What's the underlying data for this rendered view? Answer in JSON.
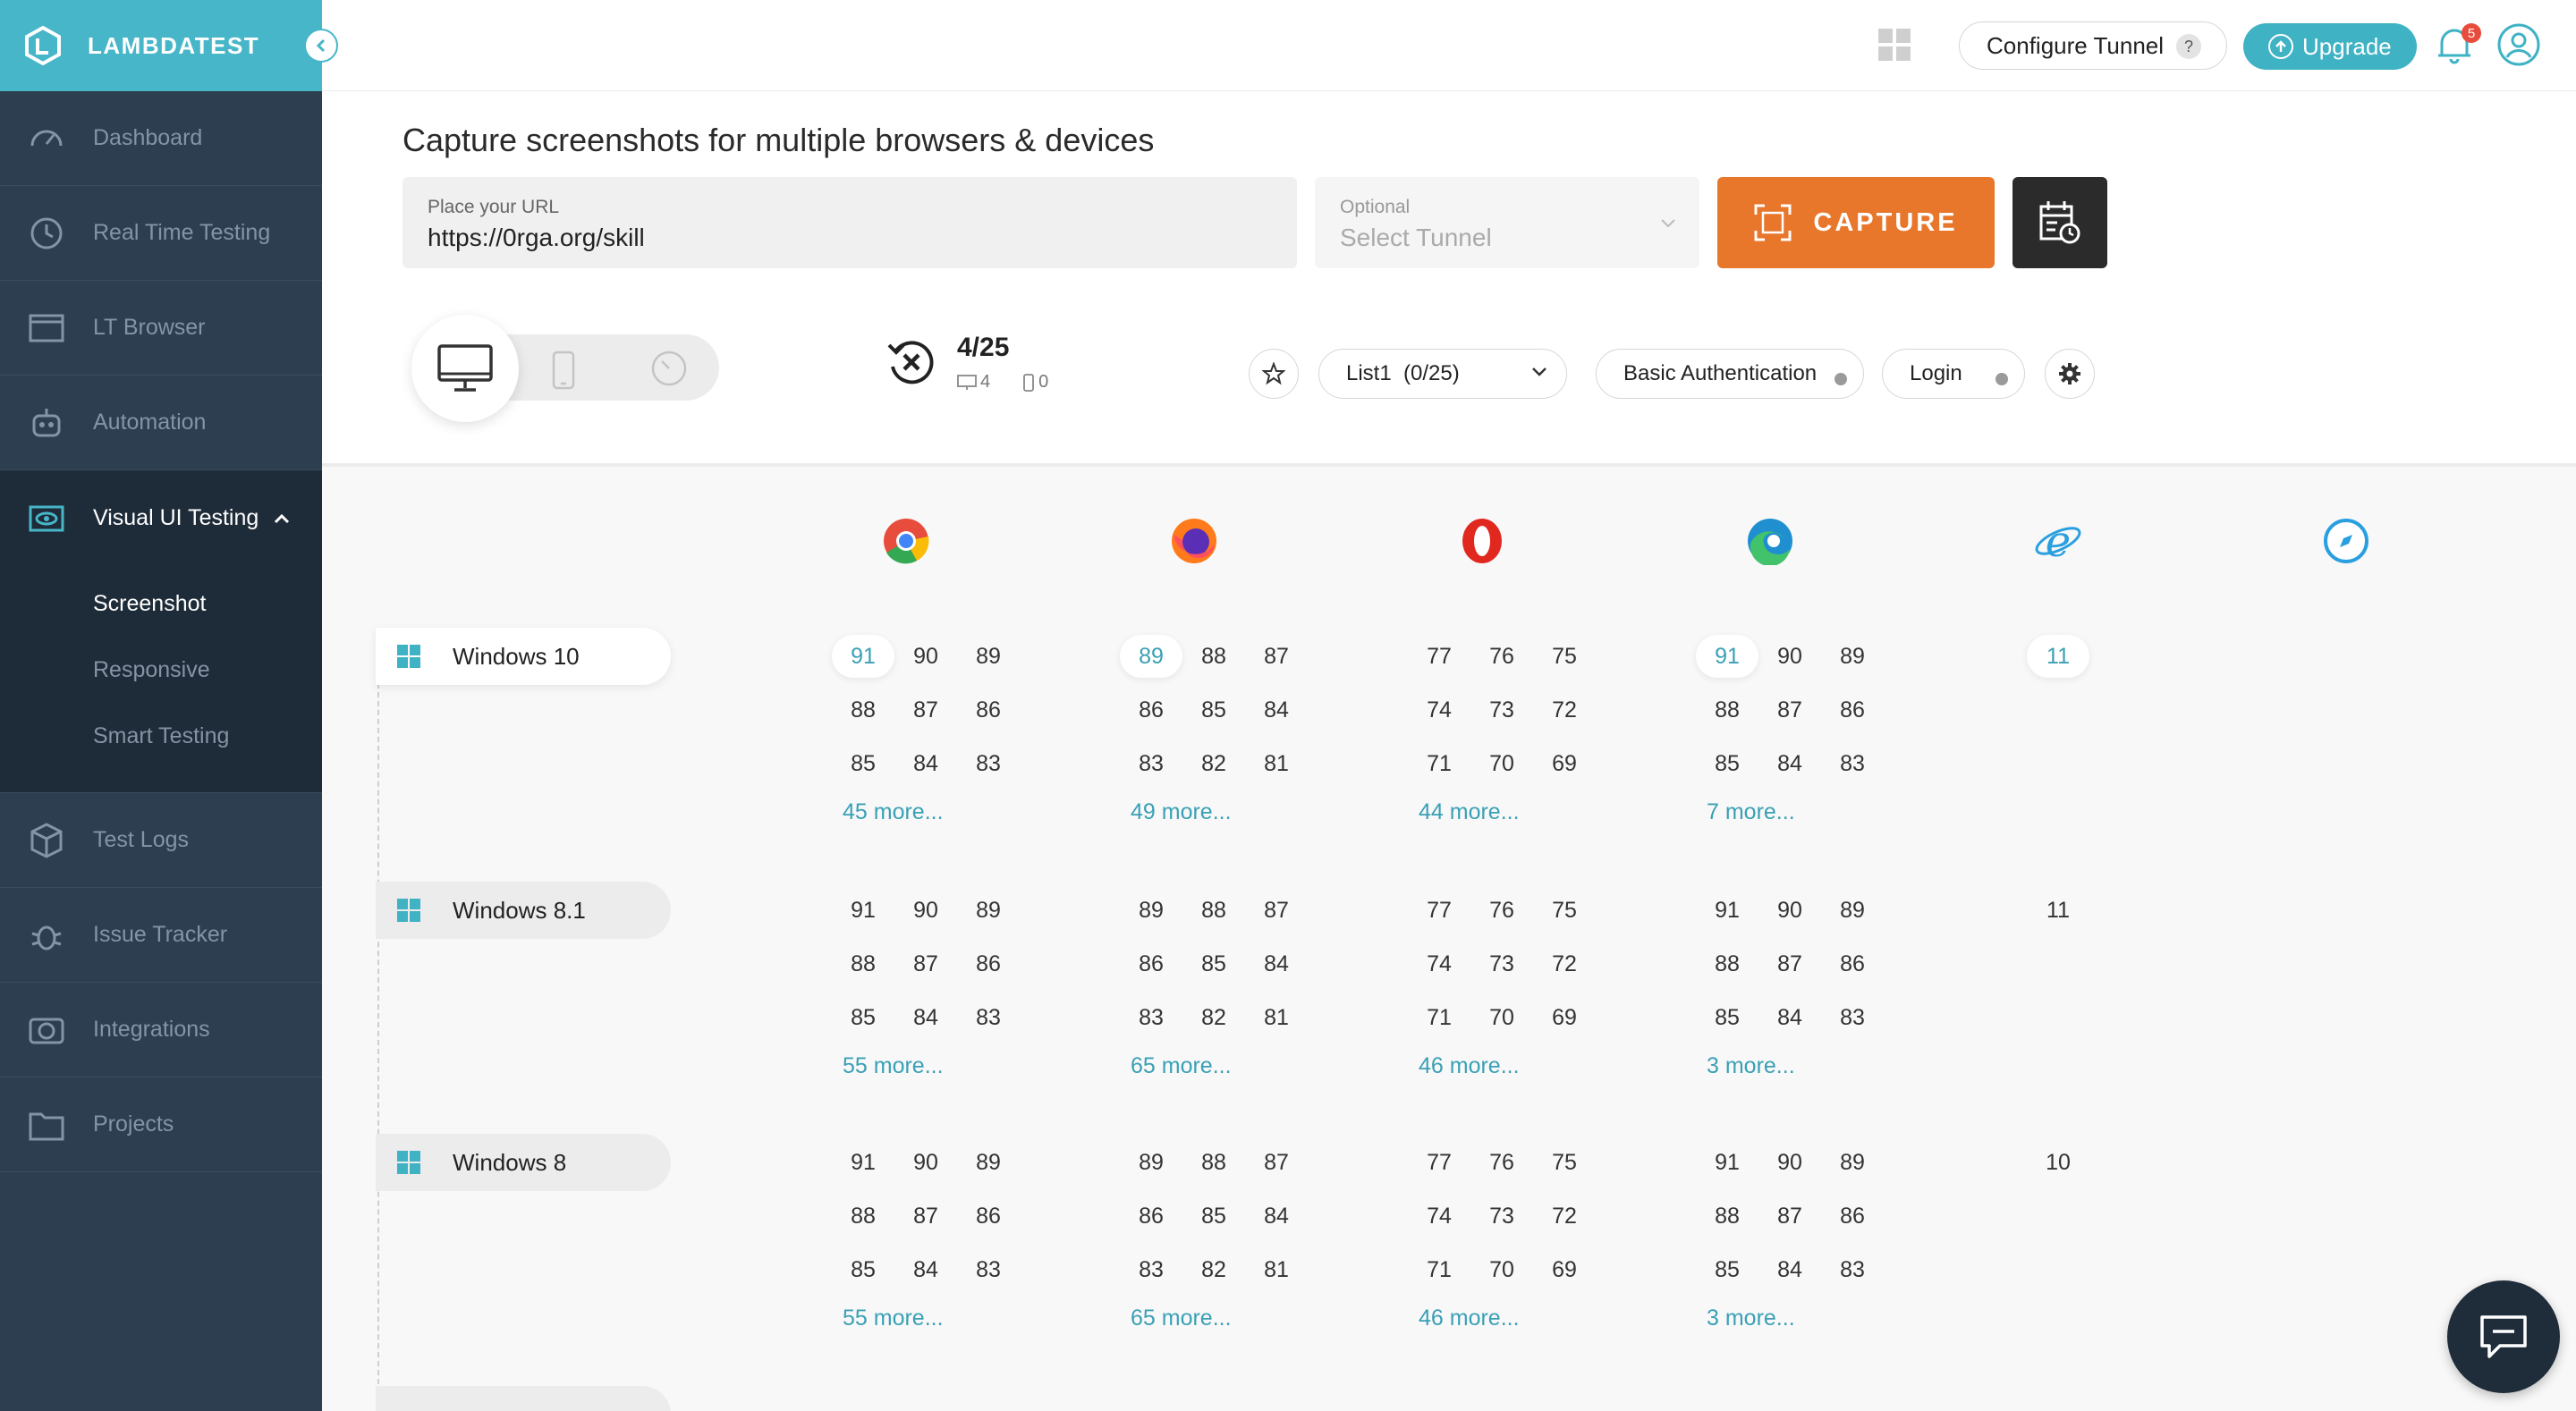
{
  "brand": {
    "name": "LAMBDATEST"
  },
  "sidebar": {
    "items": [
      {
        "label": "Dashboard",
        "icon": "speedometer-icon"
      },
      {
        "label": "Real Time Testing",
        "icon": "clock-icon"
      },
      {
        "label": "LT Browser",
        "icon": "browser-icon"
      },
      {
        "label": "Automation",
        "icon": "robot-icon"
      },
      {
        "label": "Visual UI Testing",
        "icon": "eye-icon",
        "active": true
      },
      {
        "label": "Test Logs",
        "icon": "cube-icon"
      },
      {
        "label": "Issue Tracker",
        "icon": "bug-icon"
      },
      {
        "label": "Integrations",
        "icon": "plug-icon"
      },
      {
        "label": "Projects",
        "icon": "folder-icon"
      }
    ],
    "subitems": [
      {
        "label": "Screenshot",
        "active": true
      },
      {
        "label": "Responsive"
      },
      {
        "label": "Smart Testing"
      }
    ]
  },
  "header": {
    "configure_tunnel": "Configure Tunnel",
    "help": "?",
    "upgrade": "Upgrade",
    "notification_count": "5"
  },
  "main": {
    "title": "Capture screenshots for multiple browsers & devices",
    "url_label": "Place your URL",
    "url_value": "https://0rga.org/skill",
    "tunnel_label": "Optional",
    "tunnel_placeholder": "Select Tunnel",
    "capture_label": "CAPTURE",
    "counter": "4/25",
    "desktop_count": "4",
    "mobile_count": "0",
    "list_label": "List1  (0/25)",
    "auth_label": "Basic Authentication",
    "login_label": "Login"
  },
  "browsers": [
    "chrome-icon",
    "firefox-icon",
    "opera-icon",
    "edge-icon",
    "ie-icon",
    "safari-icon"
  ],
  "os_rows": [
    {
      "name": "Windows 10",
      "chrome": [
        "91",
        "90",
        "89",
        "88",
        "87",
        "86",
        "85",
        "84",
        "83"
      ],
      "chrome_more": "45 more...",
      "firefox": [
        "89",
        "88",
        "87",
        "86",
        "85",
        "84",
        "83",
        "82",
        "81"
      ],
      "firefox_more": "49 more...",
      "opera": [
        "77",
        "76",
        "75",
        "74",
        "73",
        "72",
        "71",
        "70",
        "69"
      ],
      "opera_more": "44 more...",
      "edge": [
        "91",
        "90",
        "89",
        "88",
        "87",
        "86",
        "85",
        "84",
        "83"
      ],
      "edge_more": "7 more...",
      "ie": "11"
    },
    {
      "name": "Windows 8.1",
      "chrome": [
        "91",
        "90",
        "89",
        "88",
        "87",
        "86",
        "85",
        "84",
        "83"
      ],
      "chrome_more": "55 more...",
      "firefox": [
        "89",
        "88",
        "87",
        "86",
        "85",
        "84",
        "83",
        "82",
        "81"
      ],
      "firefox_more": "65 more...",
      "opera": [
        "77",
        "76",
        "75",
        "74",
        "73",
        "72",
        "71",
        "70",
        "69"
      ],
      "opera_more": "46 more...",
      "edge": [
        "91",
        "90",
        "89",
        "88",
        "87",
        "86",
        "85",
        "84",
        "83"
      ],
      "edge_more": "3 more...",
      "ie": "11"
    },
    {
      "name": "Windows 8",
      "chrome": [
        "91",
        "90",
        "89",
        "88",
        "87",
        "86",
        "85",
        "84",
        "83"
      ],
      "chrome_more": "55 more...",
      "firefox": [
        "89",
        "88",
        "87",
        "86",
        "85",
        "84",
        "83",
        "82",
        "81"
      ],
      "firefox_more": "65 more...",
      "opera": [
        "77",
        "76",
        "75",
        "74",
        "73",
        "72",
        "71",
        "70",
        "69"
      ],
      "opera_more": "46 more...",
      "edge": [
        "91",
        "90",
        "89",
        "88",
        "87",
        "86",
        "85",
        "84",
        "83"
      ],
      "edge_more": "3 more...",
      "ie": "10"
    }
  ],
  "colors": {
    "brand": "#46b6c8",
    "sidebar": "#2d3e50",
    "capture": "#e8762b",
    "link": "#3aa0b5"
  }
}
